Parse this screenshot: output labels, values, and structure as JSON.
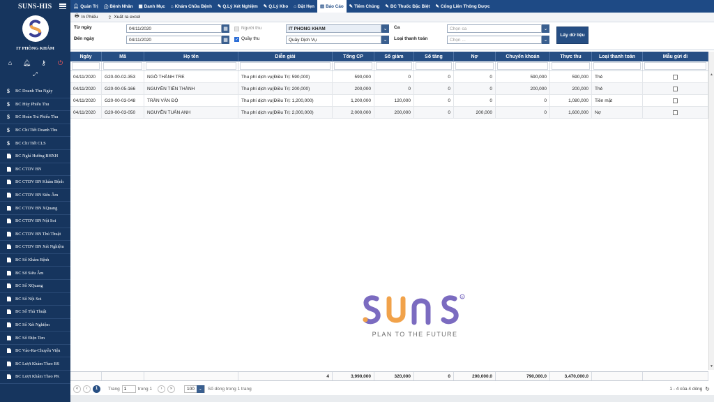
{
  "app": {
    "title": "SUNS-HIS",
    "clinic": "IT PHÒNG KHÁM"
  },
  "sidebar": {
    "items": [
      {
        "icon": "$",
        "label": "BC Doanh Thu Ngày"
      },
      {
        "icon": "$",
        "label": "BC Hủy Phiếu Thu"
      },
      {
        "icon": "$",
        "label": "BC Hoàn Trả Phiếu Thu"
      },
      {
        "icon": "$",
        "label": "BC Chi Tiết Doanh Thu"
      },
      {
        "icon": "$",
        "label": "BC Chi Tiết CLS"
      },
      {
        "icon": "doc",
        "label": "BC Nghỉ Hưởng BHXH"
      },
      {
        "icon": "doc",
        "label": "BC CTDV BN"
      },
      {
        "icon": "doc",
        "label": "BC CTDV BN Khám Bệnh"
      },
      {
        "icon": "doc",
        "label": "BC CTDV BN Siêu Âm"
      },
      {
        "icon": "doc",
        "label": "BC CTDV BN XQuang"
      },
      {
        "icon": "doc",
        "label": "BC CTDV BN Nội Soi"
      },
      {
        "icon": "doc",
        "label": "BC CTDV BN Thủ Thuật"
      },
      {
        "icon": "doc",
        "label": "BC CTDV BN Xét Nghiệm"
      },
      {
        "icon": "doc",
        "label": "BC Sổ Khám Bệnh"
      },
      {
        "icon": "doc",
        "label": "BC Sổ Siêu Âm"
      },
      {
        "icon": "doc",
        "label": "BC Sổ XQuang"
      },
      {
        "icon": "doc",
        "label": "BC Sổ Nội Soi"
      },
      {
        "icon": "doc",
        "label": "BC Sổ Thủ Thuật"
      },
      {
        "icon": "doc",
        "label": "BC Sổ Xét Nghiệm"
      },
      {
        "icon": "doc",
        "label": "BC Sổ Điện Tim"
      },
      {
        "icon": "doc",
        "label": "BC Vào-Ra-Chuyển Viện"
      },
      {
        "icon": "doc",
        "label": "BC Lượt Khám Theo BS"
      },
      {
        "icon": "doc",
        "label": "BC Lượt Khám Theo PK"
      }
    ]
  },
  "nav": {
    "items": [
      {
        "icon": "user-icon",
        "label": "Quản Trị"
      },
      {
        "icon": "info-icon",
        "label": "Bệnh Nhân"
      },
      {
        "icon": "grid-icon",
        "label": "Danh Mục"
      },
      {
        "icon": "home-icon",
        "label": "Khám Chữa Bệnh"
      },
      {
        "icon": "edit-icon",
        "label": "Q.Lý Xét Nghiệm"
      },
      {
        "icon": "edit-icon",
        "label": "Q.Lý Kho"
      },
      {
        "icon": "home-icon",
        "label": "Đặt Hẹn"
      },
      {
        "icon": "chart-icon",
        "label": "Báo Cáo",
        "active": true
      },
      {
        "icon": "pin-icon",
        "label": "Tiêm Chủng"
      },
      {
        "icon": "pin-icon",
        "label": "BC Thuốc Đặc Biệt"
      },
      {
        "icon": "pin-icon",
        "label": "Cổng Liên Thông Dược"
      }
    ]
  },
  "toolbar": {
    "print_label": "In Phiếu",
    "export_label": "Xuất ra excel"
  },
  "filters": {
    "from_label": "Từ ngày",
    "from_value": "04/11/2020",
    "to_label": "Đến ngày",
    "to_value": "04/11/2020",
    "collector_label": "Người thu",
    "collector_value": "IT PHÒNG KHÁM",
    "counter_label": "Quầy thu",
    "counter_value": "Quầy Dịch Vụ",
    "shift_label": "Ca",
    "shift_placeholder": "Chọn ca",
    "paytype_label": "Loại thanh toán",
    "paytype_placeholder": "Chọn ...",
    "fetch_label": "Lấy dữ liệu"
  },
  "grid": {
    "columns": [
      "Ngày",
      "Mã",
      "Họ tên",
      "Diễn giải",
      "Tổng CP",
      "Số giảm",
      "Số tăng",
      "Nợ",
      "Chuyển khoản",
      "Thực thu",
      "Loại thanh toán",
      "Mẫu gửi đi"
    ],
    "rows": [
      [
        "04/11/2020",
        "G20-00-02-353",
        "NGÔ THÀNH TRE",
        "Thu phí dịch vụ(Điều Trị: 590,000)",
        "590,000",
        "0",
        "0",
        "0",
        "590,000",
        "590,000",
        "Thẻ"
      ],
      [
        "04/11/2020",
        "G20-00-05-166",
        "NGUYỄN TIẾN THÀNH",
        "Thu phí dịch vụ(Điều Trị: 200,000)",
        "200,000",
        "0",
        "0",
        "0",
        "200,000",
        "200,000",
        "Thẻ"
      ],
      [
        "04/11/2020",
        "G20-00-03-048",
        "TRẦN VĂN ĐỘ",
        "Thu phí dịch vụ(Điều Trị: 1,200,000)",
        "1,200,000",
        "120,000",
        "0",
        "0",
        "0",
        "1,080,000",
        "Tiền mặt"
      ],
      [
        "04/11/2020",
        "G20-00-03-050",
        "NGUYỄN TUẤN ANH",
        "Thu phí dịch vụ(Điều Trị: 2,000,000)",
        "2,000,000",
        "200,000",
        "0",
        "200,000",
        "0",
        "1,600,000",
        "Nợ"
      ]
    ],
    "totals": {
      "count": "4",
      "tong_cp": "3,990,000",
      "so_giam": "320,000",
      "so_tang": "0",
      "no": "200,000.0",
      "chuyen_khoan": "790,000.0",
      "thuc_thu": "3,470,000.0"
    }
  },
  "pager": {
    "page_label": "Trang",
    "page_value": "1",
    "of_label": "trong 1",
    "size_value": "100",
    "size_label": "Số dòng trong 1 trang",
    "right_label": "1 - 4 của 4 dòng"
  },
  "watermark": {
    "brand": "SUNS",
    "tagline": "PLAN TO THE FUTURE"
  },
  "colors": {
    "sidebar": "#16355e",
    "nav": "#1e4a85",
    "header": "#264e83",
    "brand_purple": "#7b6bc0",
    "brand_orange": "#f1a24a"
  }
}
